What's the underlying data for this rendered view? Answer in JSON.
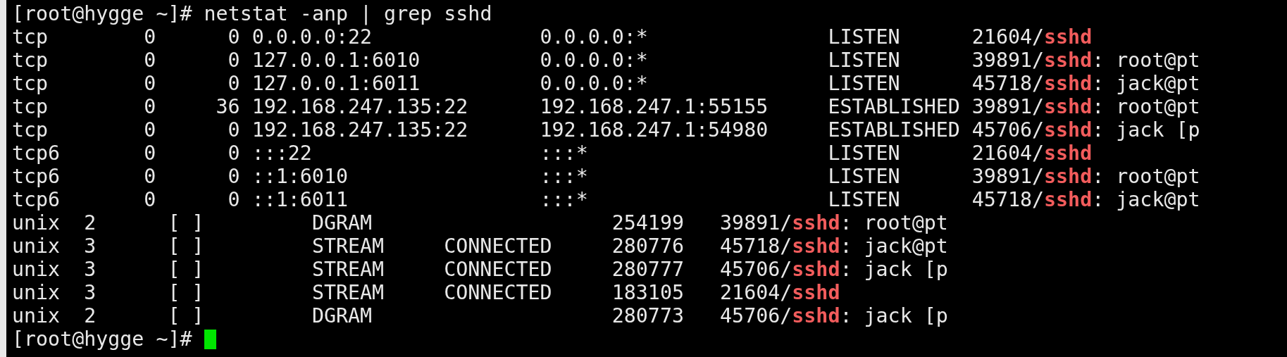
{
  "terminal": {
    "lines": [
      {
        "kind": "prompt",
        "prompt": "[root@hygge ~]#",
        "command": "netstat -anp | grep sshd",
        "cursor": false
      },
      {
        "kind": "inet",
        "cells": [
          "tcp",
          "0",
          "0",
          "0.0.0.0:22",
          "0.0.0.0:*",
          "LISTEN",
          "21604/**sshd**"
        ]
      },
      {
        "kind": "inet",
        "cells": [
          "tcp",
          "0",
          "0",
          "127.0.0.1:6010",
          "0.0.0.0:*",
          "LISTEN",
          "39891/**sshd**: root@pt"
        ]
      },
      {
        "kind": "inet",
        "cells": [
          "tcp",
          "0",
          "0",
          "127.0.0.1:6011",
          "0.0.0.0:*",
          "LISTEN",
          "45718/**sshd**: jack@pt"
        ]
      },
      {
        "kind": "inet",
        "cells": [
          "tcp",
          "0",
          "36",
          "192.168.247.135:22",
          "192.168.247.1:55155",
          "ESTABLISHED",
          "39891/**sshd**: root@pt"
        ]
      },
      {
        "kind": "inet",
        "cells": [
          "tcp",
          "0",
          "0",
          "192.168.247.135:22",
          "192.168.247.1:54980",
          "ESTABLISHED",
          "45706/**sshd**: jack [p"
        ]
      },
      {
        "kind": "inet",
        "cells": [
          "tcp6",
          "0",
          "0",
          ":::22",
          ":::*",
          "LISTEN",
          "21604/**sshd**"
        ]
      },
      {
        "kind": "inet",
        "cells": [
          "tcp6",
          "0",
          "0",
          "::1:6010",
          ":::*",
          "LISTEN",
          "39891/**sshd**: root@pt"
        ]
      },
      {
        "kind": "inet",
        "cells": [
          "tcp6",
          "0",
          "0",
          "::1:6011",
          ":::*",
          "LISTEN",
          "45718/**sshd**: jack@pt"
        ]
      },
      {
        "kind": "unix",
        "cells": [
          "unix",
          "2",
          "[ ]",
          "DGRAM",
          "",
          "254199",
          "39891/**sshd**: root@pt"
        ]
      },
      {
        "kind": "unix",
        "cells": [
          "unix",
          "3",
          "[ ]",
          "STREAM",
          "CONNECTED",
          "280776",
          "45718/**sshd**: jack@pt"
        ]
      },
      {
        "kind": "unix",
        "cells": [
          "unix",
          "3",
          "[ ]",
          "STREAM",
          "CONNECTED",
          "280777",
          "45706/**sshd**: jack [p"
        ]
      },
      {
        "kind": "unix",
        "cells": [
          "unix",
          "3",
          "[ ]",
          "STREAM",
          "CONNECTED",
          "183105",
          "21604/**sshd**"
        ]
      },
      {
        "kind": "unix",
        "cells": [
          "unix",
          "2",
          "[ ]",
          "DGRAM",
          "",
          "280773",
          "45706/**sshd**: jack [p"
        ]
      },
      {
        "kind": "prompt",
        "prompt": "[root@hygge ~]#",
        "cursor": true
      }
    ]
  }
}
